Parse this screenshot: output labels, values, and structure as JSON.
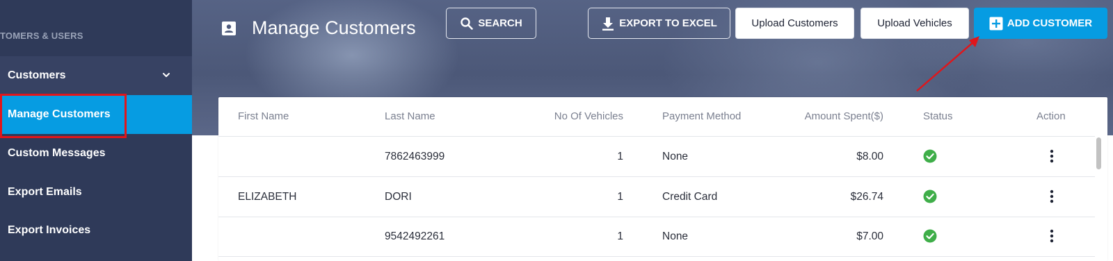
{
  "sidebar": {
    "section_label": "TOMERS & USERS",
    "items": [
      {
        "label": "Customers"
      },
      {
        "label": "Manage Customers"
      },
      {
        "label": "Custom Messages"
      },
      {
        "label": "Export Emails"
      },
      {
        "label": "Export Invoices"
      }
    ]
  },
  "header": {
    "title": "Manage Customers",
    "title_icon": "contact-card-icon",
    "search_label": "SEARCH",
    "export_label": "EXPORT TO EXCEL",
    "upload_customers_label": "Upload Customers",
    "upload_vehicles_label": "Upload Vehicles",
    "add_customer_label": "ADD CUSTOMER"
  },
  "table": {
    "columns": [
      "First Name",
      "Last Name",
      "No Of Vehicles",
      "Payment Method",
      "Amount Spent($)",
      "Status",
      "Action"
    ],
    "rows": [
      {
        "first_name": "",
        "last_name": "7862463999",
        "vehicles": "1",
        "payment": "None",
        "amount": "$8.00",
        "status": "active"
      },
      {
        "first_name": "ELIZABETH",
        "last_name": "DORI",
        "vehicles": "1",
        "payment": "Credit Card",
        "amount": "$26.74",
        "status": "active"
      },
      {
        "first_name": "",
        "last_name": "9542492261",
        "vehicles": "1",
        "payment": "None",
        "amount": "$7.00",
        "status": "active"
      }
    ]
  },
  "colors": {
    "sidebar_bg": "#2f3a59",
    "accent": "#069ce2",
    "highlight_outline": "#e0161b",
    "status_ok": "#3fae49"
  }
}
